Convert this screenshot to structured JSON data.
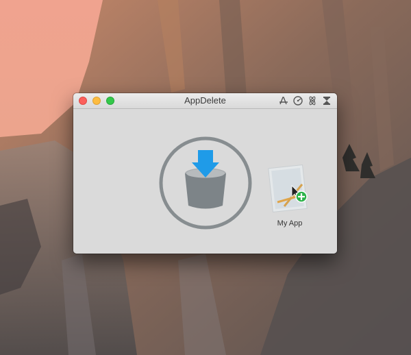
{
  "window": {
    "title": "AppDelete",
    "toolbar_icons": [
      "app-store-icon",
      "disk-icon",
      "atom-icon",
      "hourglass-icon"
    ]
  },
  "drop_zone": {
    "icon": "trash-download-icon",
    "arrow_color": "#1f9be8"
  },
  "dropped_app": {
    "label": "My App",
    "icon": "app-icon",
    "badge": "plus-icon",
    "badge_color": "#2db34a"
  }
}
